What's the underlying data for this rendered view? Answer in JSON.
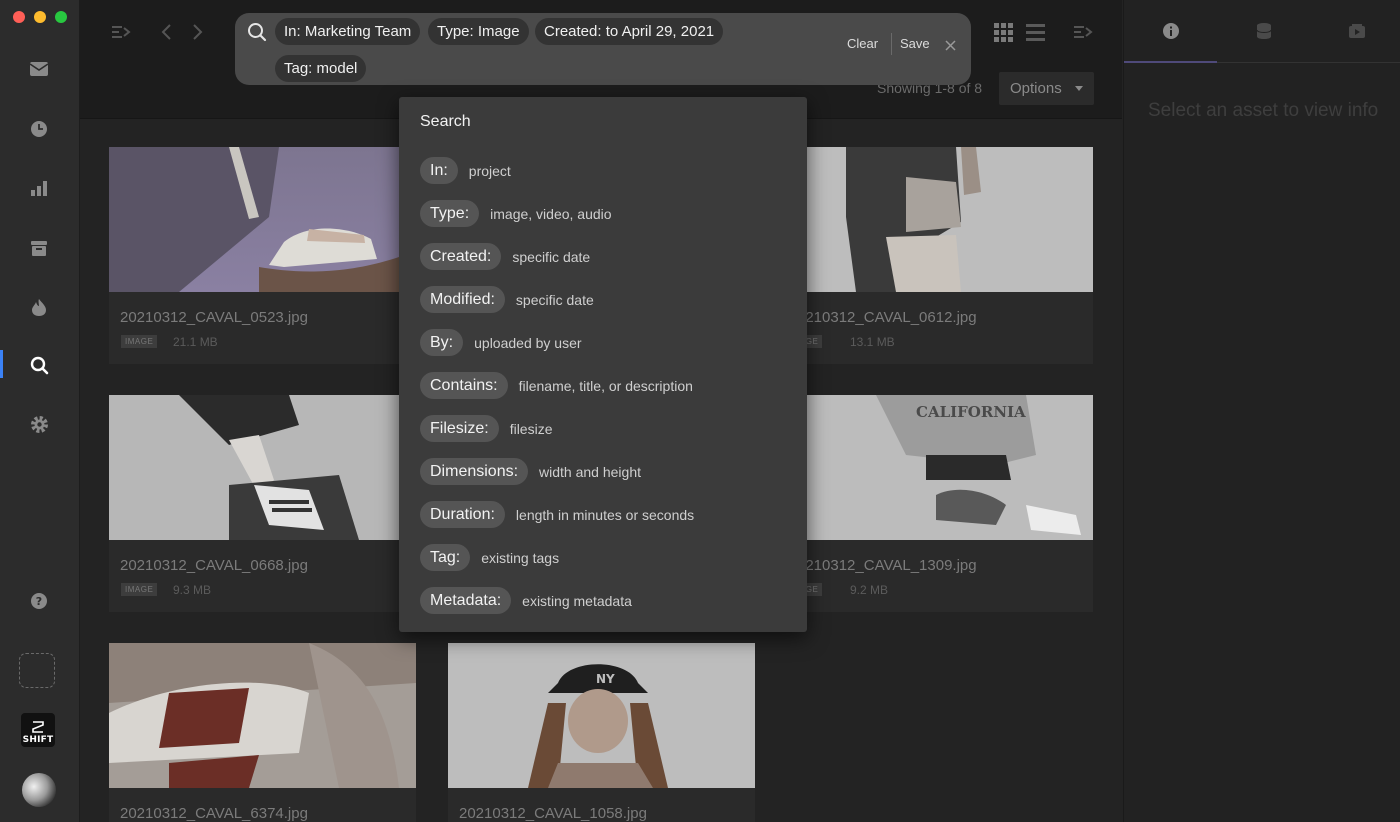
{
  "search": {
    "chips": [
      {
        "key": "In:",
        "value": "Marketing Team"
      },
      {
        "key": "Type:",
        "value": "Image"
      },
      {
        "key": "Created:",
        "value": "to April 29, 2021"
      },
      {
        "key": "Tag:",
        "value": "model"
      }
    ],
    "clear_label": "Clear",
    "save_label": "Save"
  },
  "results": {
    "showing": "Showing 1-8 of 8",
    "options_label": "Options"
  },
  "assets": [
    {
      "filename": "20210312_CAVAL_0523.jpg",
      "type": "IMAGE",
      "size": "21.1 MB"
    },
    {
      "filename": "0210312_CAVAL_0612.jpg",
      "type": "IMAGE",
      "size": "13.1 MB"
    },
    {
      "filename": "20210312_CAVAL_0668.jpg",
      "type": "IMAGE",
      "size": "9.3 MB"
    },
    {
      "filename": "0210312_CAVAL_1309.jpg",
      "type": "IMAGE",
      "size": "9.2 MB"
    },
    {
      "filename": "20210312_CAVAL_6374.jpg",
      "type": "",
      "size": ""
    },
    {
      "filename": "20210312_CAVAL_1058.jpg",
      "type": "",
      "size": ""
    }
  ],
  "dropdown": {
    "title": "Search",
    "options": [
      {
        "key": "In:",
        "desc": "project"
      },
      {
        "key": "Type:",
        "desc": "image, video, audio"
      },
      {
        "key": "Created:",
        "desc": "specific date"
      },
      {
        "key": "Modified:",
        "desc": "specific date"
      },
      {
        "key": "By:",
        "desc": "uploaded by user"
      },
      {
        "key": "Contains:",
        "desc": "filename, title, or description"
      },
      {
        "key": "Filesize:",
        "desc": "filesize"
      },
      {
        "key": "Dimensions:",
        "desc": "width and height"
      },
      {
        "key": "Duration:",
        "desc": "length in minutes or seconds"
      },
      {
        "key": "Tag:",
        "desc": "existing tags"
      },
      {
        "key": "Metadata:",
        "desc": "existing metadata"
      }
    ]
  },
  "info_panel": {
    "empty_message": "Select an asset to view info"
  },
  "shift_logo_text": "SHIFT",
  "icons": {
    "sidebar": [
      "inbox-icon",
      "clock-icon",
      "bar-chart-icon",
      "archive-icon",
      "flame-icon",
      "search-icon",
      "gear-icon",
      "help-icon"
    ],
    "toolbar": [
      "sidebar-toggle-icon",
      "back-arrow-icon",
      "forward-arrow-icon",
      "grid-view-icon",
      "list-view-icon",
      "panel-toggle-icon"
    ],
    "right_tabs": [
      "info-icon",
      "database-icon",
      "media-icon"
    ]
  },
  "colors": {
    "accent": "#3b82f6",
    "tab_underline": "#4f4a7a",
    "window_close": "#ff5f57",
    "window_minimize": "#febc2e",
    "window_zoom": "#28c840"
  }
}
